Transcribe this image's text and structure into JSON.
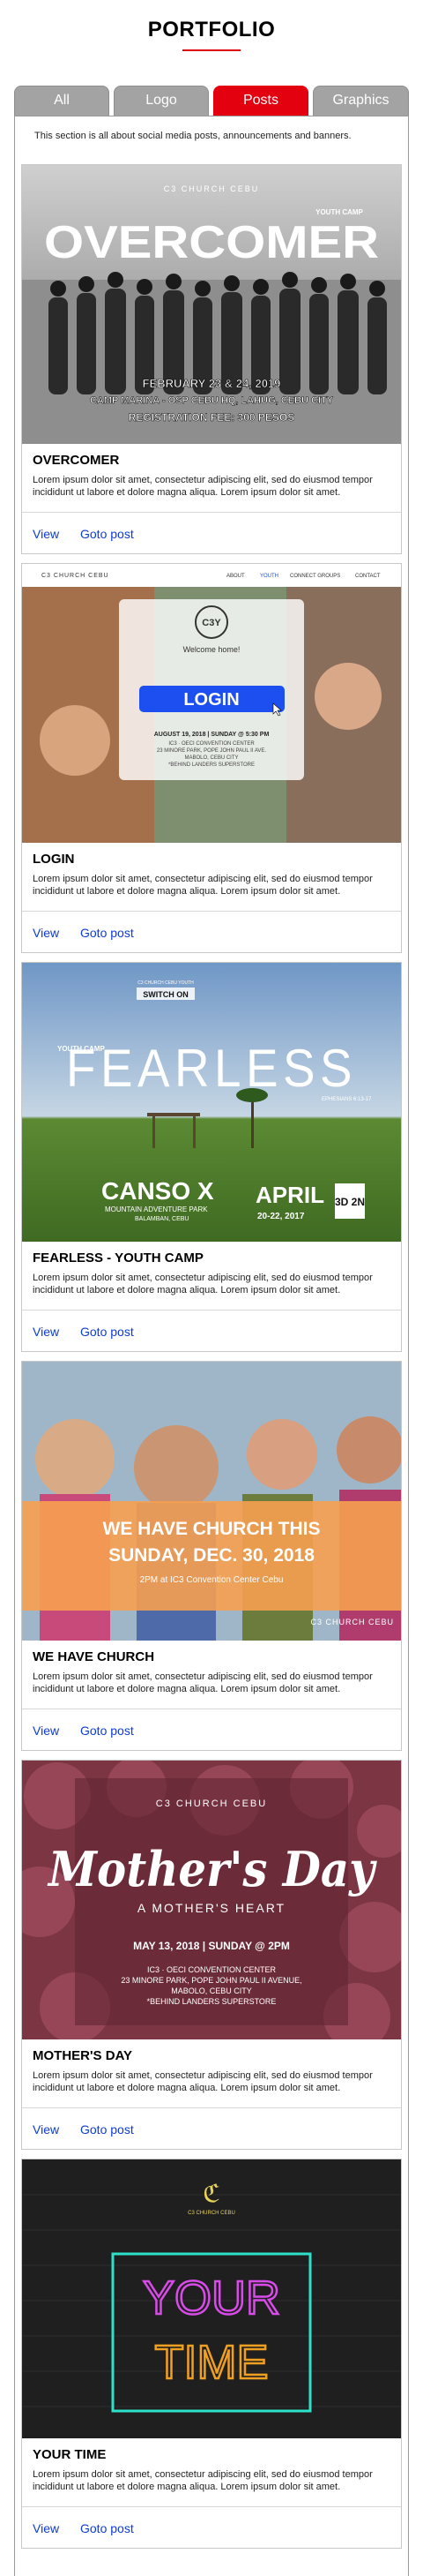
{
  "page": {
    "title": "PORTFOLIO"
  },
  "tabs": [
    {
      "label": "All"
    },
    {
      "label": "Logo"
    },
    {
      "label": "Posts"
    },
    {
      "label": "Graphics"
    }
  ],
  "intro_text": "This section is all about social media posts, announcements and banners.",
  "common": {
    "description": "Lorem ipsum dolor sit amet, consectetur adipiscing elit, sed do eiusmod tempor incididunt ut labore et dolore magna aliqua. Lorem ipsum dolor sit amet.",
    "view_label": "View",
    "goto_label": "Goto post"
  },
  "posts": [
    {
      "title": "OVERCOMER",
      "image": {
        "brand": "C3 CHURCH CEBU",
        "tag": "YOUTH CAMP",
        "headline": "OVERCOMER",
        "date": "FEBRUARY 23 & 24, 2019",
        "venue": "CAMP MARINA - OSP CEBU HQ, LAHUG, CEBU CITY",
        "fee": "REGISTRATION FEE: 300 PESOS"
      }
    },
    {
      "title": "LOGIN",
      "image": {
        "brand": "C3 CHURCH CEBU",
        "nav": [
          "ABOUT",
          "YOUTH",
          "CONNECT GROUPS",
          "CONTACT"
        ],
        "logo": "C3Y",
        "welcome": "Welcome home!",
        "button": "LOGIN",
        "event_date": "AUGUST 19, 2018 | SUNDAY @ 5:30 PM",
        "venue_lines": [
          "IC3 · OECI CONVENTION CENTER",
          "23 MINORE PARK, POPE JOHN PAUL II AVE.",
          "MABOLO, CEBU CITY",
          "*BEHIND LANDERS SUPERSTORE"
        ]
      }
    },
    {
      "title": "FEARLESS - YOUTH CAMP",
      "image": {
        "top_tag": "C3 CHURCH CEBU YOUTH",
        "badge": "SWITCH ON",
        "tag": "YOUTH CAMP",
        "headline": "FEARLESS",
        "subline": "EPHESIANS 6:13-17",
        "location": "CANSO X",
        "location_sub": "MOUNTAIN ADVENTURE PARK",
        "location_city": "BALAMBAN, CEBU",
        "date": "APRIL",
        "date_days": "20-22, 2017",
        "duration": "3D 2N"
      }
    },
    {
      "title": "WE HAVE CHURCH",
      "image": {
        "headline1": "WE HAVE CHURCH THIS",
        "headline2": "SUNDAY, DEC. 30, 2018",
        "detail": "2PM at IC3 Convention Center Cebu",
        "brand": "C3 CHURCH CEBU"
      }
    },
    {
      "title": "MOTHER'S DAY",
      "image": {
        "brand": "C3 CHURCH CEBU",
        "headline": "Mother's Day",
        "subline": "A MOTHER'S HEART",
        "date": "MAY 13, 2018 | SUNDAY @ 2PM",
        "venue_lines": [
          "IC3 · OECI CONVENTION CENTER",
          "23 MINORE PARK, POPE JOHN PAUL II AVENUE,",
          "MABOLO, CEBU CITY",
          "*BEHIND LANDERS SUPERSTORE"
        ]
      }
    },
    {
      "title": "YOUR TIME",
      "image": {
        "brand": "C3 CHURCH CEBU",
        "line1": "YOUR",
        "line2": "TIME"
      }
    }
  ],
  "colors": {
    "accent": "#e3000f",
    "tab_inactive": "#a3a3a3",
    "link": "#0e3bd6"
  }
}
